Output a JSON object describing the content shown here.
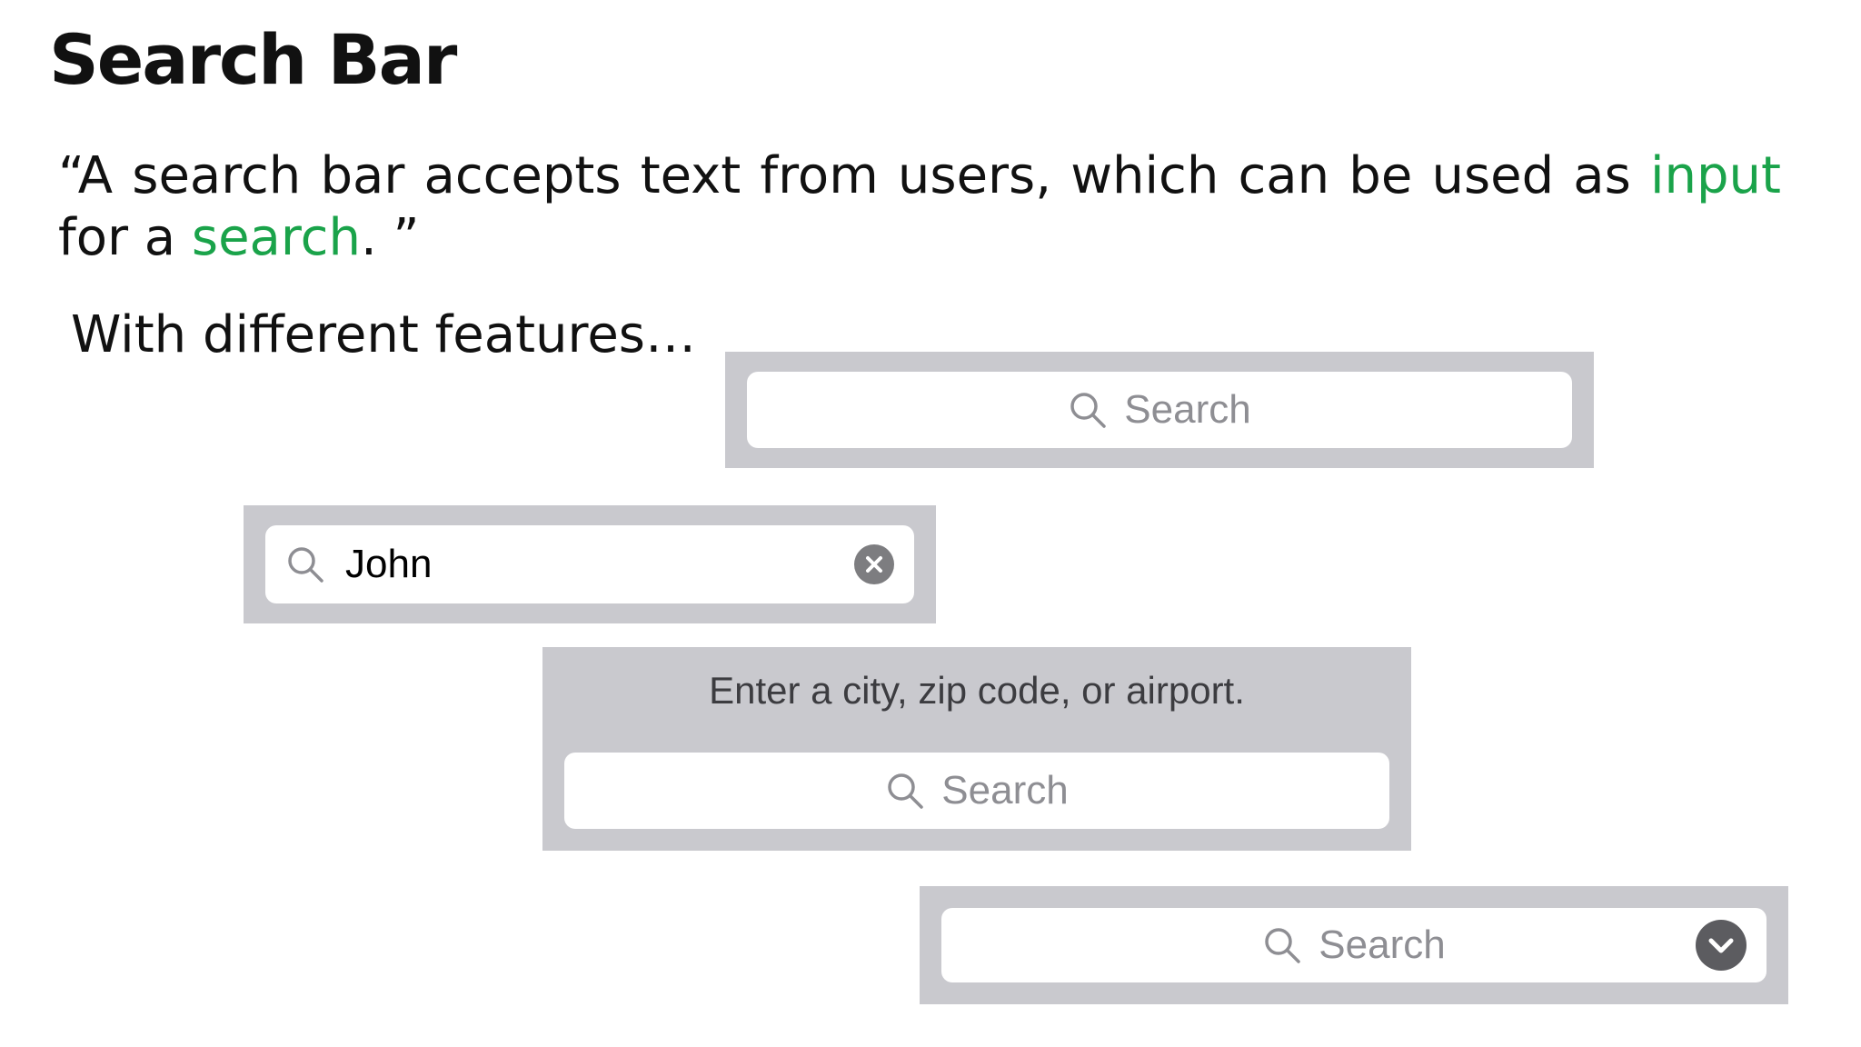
{
  "slide": {
    "title": "Search Bar",
    "quote": {
      "open": "“A search bar accepts text from users, which can be used as ",
      "highlight_1": "input",
      "middle": " for a ",
      "highlight_2": "search",
      "close": ". ”"
    },
    "features_text": "With different features…",
    "highlight_color": "#1aa34a"
  },
  "search_bars": [
    {
      "placeholder": "Search",
      "icon": "magnifying-glass-icon"
    },
    {
      "value": "John",
      "icon": "magnifying-glass-icon",
      "trailing_icon": "clear-circle-icon"
    },
    {
      "prompt": "Enter a city, zip code, or airport.",
      "placeholder": "Search",
      "icon": "magnifying-glass-icon"
    },
    {
      "placeholder": "Search",
      "icon": "magnifying-glass-icon",
      "trailing_icon": "chevron-down-circle-icon"
    }
  ],
  "colors": {
    "bar_background": "#c9c9ce",
    "field_background": "#ffffff",
    "placeholder_text": "#8e8e93"
  }
}
